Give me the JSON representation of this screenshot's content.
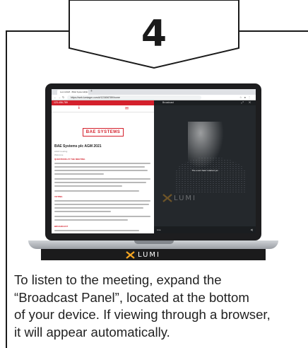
{
  "step": {
    "number": "4"
  },
  "browser": {
    "tab_label": "Lumi AGM - BAE Systems plc",
    "url": "https://web.lumiagm.com/#/123456789/home"
  },
  "app": {
    "meeting_id": "123-456-789",
    "company_logo": "BAE SYSTEMS",
    "document_title": "BAE Systems plc AGM 2021",
    "meeting_label": "AGM meeting",
    "welcome_label": "Welcome",
    "section_questions": "QUESTIONS AT THE MEETING",
    "section_voting": "VOTING",
    "section_broadcast": "BROADCAST"
  },
  "broadcast": {
    "title": "Broadcast",
    "status": "The event hasn't started yet",
    "live_label": "Live",
    "watermark": "LUMI"
  },
  "laptop": {
    "brand": "LUMI"
  },
  "instruction": {
    "lines": [
      "To listen to the meeting, expand the",
      "“Broadcast Panel”, located at the bottom",
      "of your device. If viewing through a browser,",
      "it will appear automatically."
    ]
  }
}
